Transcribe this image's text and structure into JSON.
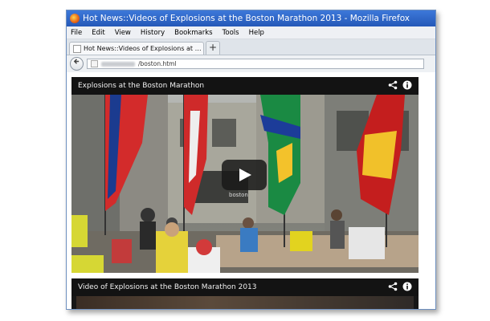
{
  "window": {
    "title": "Hot News::Videos of Explosions at the Boston Marathon 2013 - Mozilla Firefox"
  },
  "menu": [
    "File",
    "Edit",
    "View",
    "History",
    "Bookmarks",
    "Tools",
    "Help"
  ],
  "tab": {
    "label": "Hot News::Videos of Explosions at the Bos...",
    "new_tab_label": "+"
  },
  "url": {
    "visible_text": "/boston.html"
  },
  "videos": [
    {
      "title": "Explosions at the Boston Marathon",
      "share_icon": "share-icon",
      "info_icon": "info-icon"
    },
    {
      "title": "Video of Explosions at the Boston Marathon 2013",
      "share_icon": "share-icon",
      "info_icon": "info-icon"
    }
  ],
  "scene_sign": "boston"
}
